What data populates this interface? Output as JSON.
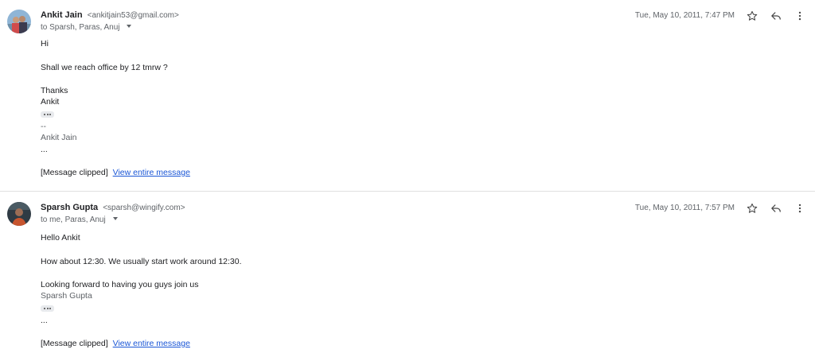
{
  "messages": [
    {
      "sender_name": "Ankit Jain",
      "sender_email": "<ankitjain53@gmail.com>",
      "recipients": "to Sparsh, Paras, Anuj",
      "date": "Tue, May 10, 2011, 7:47 PM",
      "lines": [
        "Hi",
        "Shall we reach office by 12 tmrw ?",
        "Thanks",
        "Ankit"
      ],
      "sig_separator": "--",
      "signature": "Ankit Jain",
      "dots": "...",
      "clipped_label": "[Message clipped]",
      "view_link": "View entire message"
    },
    {
      "sender_name": "Sparsh Gupta",
      "sender_email": "<sparsh@wingify.com>",
      "recipients": "to me, Paras, Anuj",
      "date": "Tue, May 10, 2011, 7:57 PM",
      "lines": [
        "Hello Ankit",
        "How about 12:30. We usually start work around 12:30.",
        "Looking forward to having you guys join us"
      ],
      "signature": "Sparsh Gupta",
      "dots": "...",
      "clipped_label": "[Message clipped]",
      "view_link": "View entire message"
    }
  ],
  "icons": {
    "star": "star-icon",
    "reply": "reply-icon",
    "more": "more-vert-icon",
    "caret": "chevron-down-icon",
    "ellipsis": "more-horiz-icon"
  }
}
